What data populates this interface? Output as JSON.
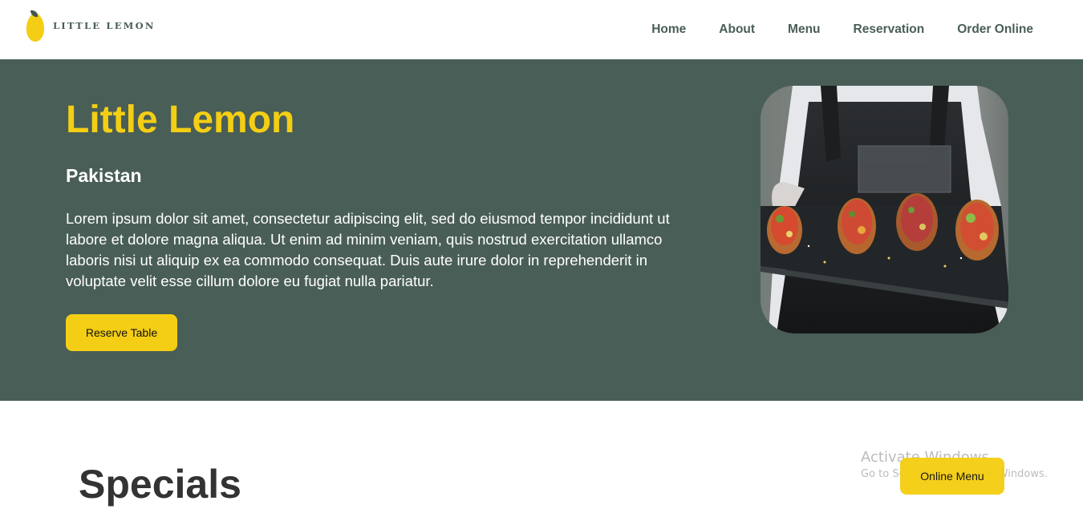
{
  "brand": {
    "logo_text": "LITTLE LEMON",
    "accent_color": "#f4ce14",
    "primary_color": "#495e57"
  },
  "nav": {
    "items": [
      {
        "label": "Home"
      },
      {
        "label": "About"
      },
      {
        "label": "Menu"
      },
      {
        "label": "Reservation"
      },
      {
        "label": "Order Online"
      }
    ]
  },
  "hero": {
    "title": "Little Lemon",
    "subtitle": "Pakistan",
    "description": "Lorem ipsum dolor sit amet, consectetur adipiscing elit, sed do eiusmod tempor incididunt ut labore et dolore magna aliqua. Ut enim ad minim veniam, quis nostrud exercitation ullamco laboris nisi ut aliquip ex ea commodo consequat. Duis aute irure dolor in reprehenderit in voluptate velit esse cillum dolore eu fugiat nulla pariatur.",
    "reserve_button": "Reserve Table",
    "image_icon": "food-platter-photo"
  },
  "specials": {
    "title": "Specials",
    "online_menu_button": "Online Menu"
  },
  "watermark": {
    "title": "Activate Windows",
    "subtitle": "Go to Settings to activate Windows."
  }
}
